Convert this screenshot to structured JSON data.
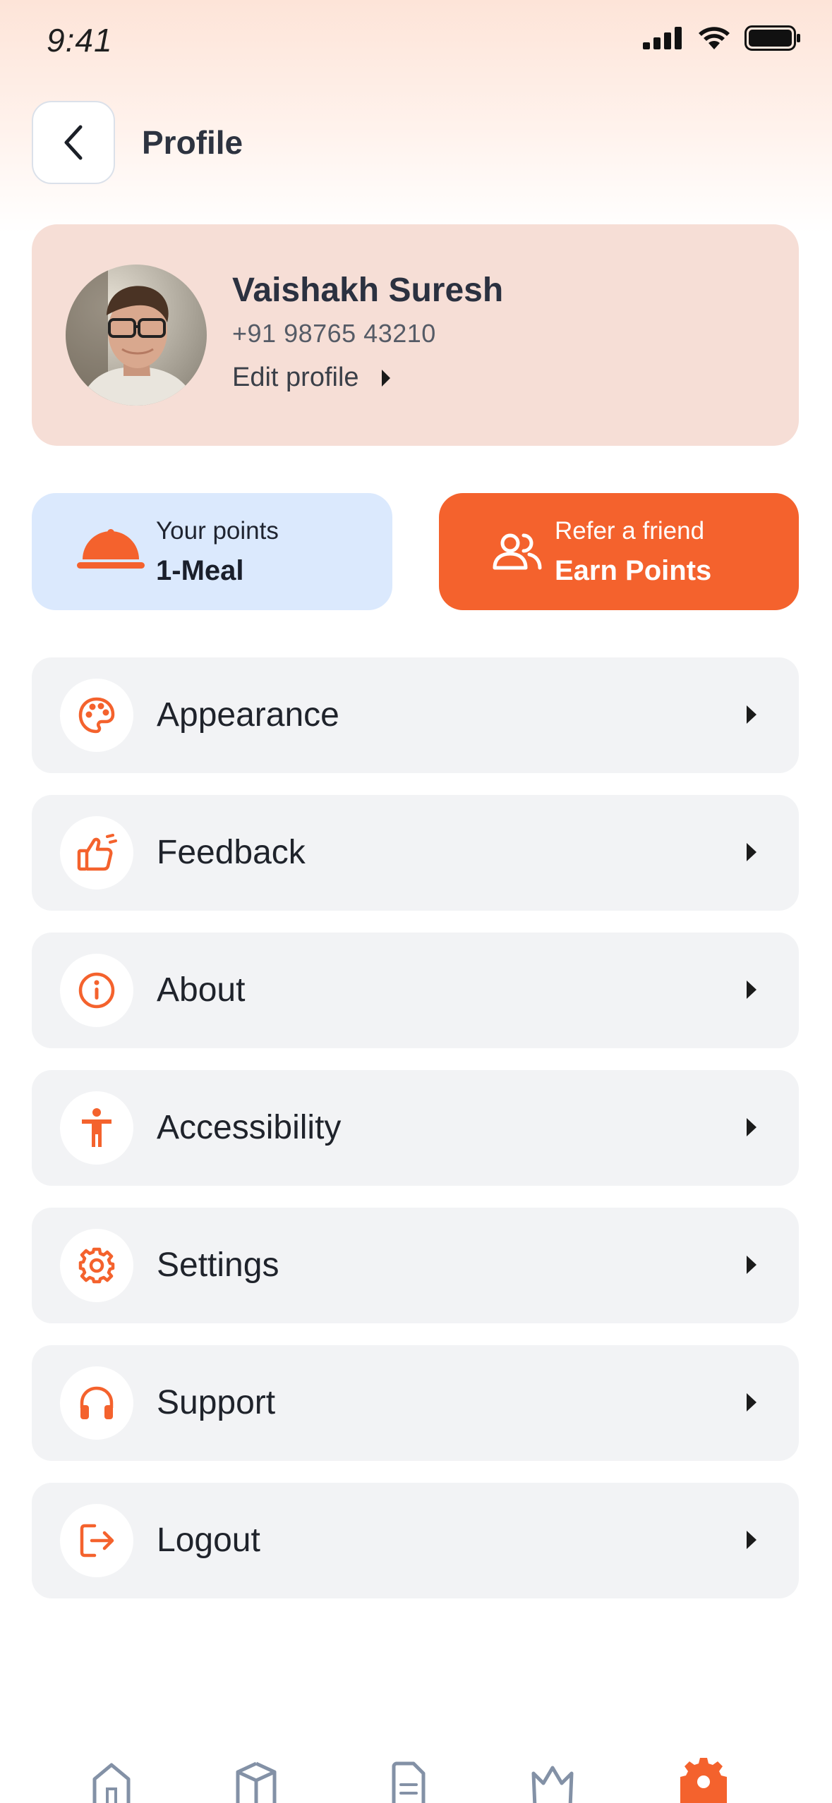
{
  "status_bar": {
    "time": "9:41"
  },
  "header": {
    "title": "Profile"
  },
  "profile": {
    "name": "Vaishakh Suresh",
    "phone": "+91  98765 43210",
    "edit_label": "Edit profile"
  },
  "points_card": {
    "label": "Your points",
    "value": "1-Meal"
  },
  "refer_card": {
    "label": "Refer a friend",
    "value": "Earn Points"
  },
  "menu": {
    "items": [
      {
        "label": "Appearance",
        "icon": "palette-icon"
      },
      {
        "label": "Feedback",
        "icon": "thumbs-up-icon"
      },
      {
        "label": "About",
        "icon": "info-icon"
      },
      {
        "label": "Accessibility",
        "icon": "accessibility-icon"
      },
      {
        "label": "Settings",
        "icon": "gear-icon"
      },
      {
        "label": "Support",
        "icon": "headphones-icon"
      },
      {
        "label": "Logout",
        "icon": "logout-icon"
      }
    ]
  },
  "bottom_nav": {
    "items": [
      "home-icon",
      "box-icon",
      "document-icon",
      "crown-icon",
      "settings-icon"
    ],
    "active": "settings-icon"
  },
  "colors": {
    "accent": "#f4622d",
    "profile_card_bg": "#f6ded6",
    "points_card_bg": "#dbe9fd",
    "menu_item_bg": "#f2f3f5",
    "nav_inactive": "#8391a6"
  }
}
